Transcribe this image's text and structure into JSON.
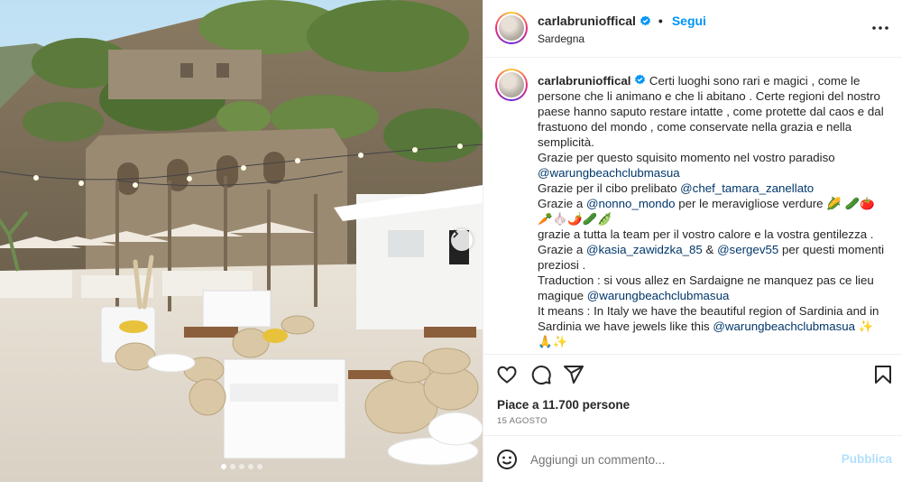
{
  "header": {
    "username": "carlabrunioffical",
    "separator": "•",
    "follow_label": "Segui",
    "location": "Sardegna"
  },
  "caption": {
    "username": "carlabrunioffical",
    "lines": {
      "intro": "Certi luoghi sono rari e magici , come le persone che li animano e che li abitano . Certe regioni del nostro paese hanno saputo restare intatte , come protette dal caos e dal frastuono del mondo , come conservate nella grazia e nella semplicità.",
      "thanks1_text": "Grazie per questo squisito momento nel vostro paradiso",
      "thanks1_mention": "@warungbeachclubmasua",
      "thanks2_text": "Grazie per il cibo prelibato",
      "thanks2_mention": "@chef_tamara_zanellato",
      "thanks3_text": "Grazie a",
      "thanks3_mention": "@nonno_mondo",
      "thanks3_rest": "per le meravigliose verdure 🌽 🥒🍅",
      "thanks3_emoji2": "🥕🧄🌶️🥒🫛",
      "thanks4": "grazie a tutta la team per il vostro calore e la vostra gentilezza .",
      "thanks5_text": "Grazie a",
      "thanks5_mention1": "@kasia_zawidzka_85",
      "thanks5_amp": "&",
      "thanks5_mention2": "@sergev55",
      "thanks5_rest": "per questi momenti preziosi .",
      "fr_text": "Traduction : si vous allez en Sardaigne ne manquez pas ce lieu magique",
      "fr_mention": "@warungbeachclubmasua",
      "en_text": "It means : In Italy we have the beautiful region of Sardinia and in Sardinia we have jewels like this",
      "en_mention": "@warungbeachclubmasua",
      "en_emoji": "✨",
      "end_emoji": "🙏✨"
    }
  },
  "actions": {
    "like_icon": "heart-icon",
    "comment_icon": "comment-icon",
    "share_icon": "paper-plane-icon",
    "save_icon": "bookmark-icon"
  },
  "likes_text": "Piace a 11.700 persone",
  "date_text": "15 AGOSTO",
  "comment": {
    "placeholder": "Aggiungi un commento...",
    "publish_label": "Pubblica"
  },
  "carousel": {
    "slide_count": 5,
    "active_index": 0
  },
  "colors": {
    "follow": "#0095f6",
    "mention": "#00376b",
    "publish_disabled": "#b2dffc",
    "verified": "#0095f6"
  }
}
